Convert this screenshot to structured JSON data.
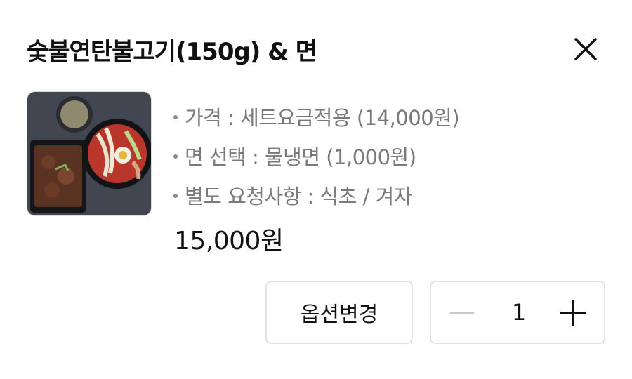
{
  "header": {
    "title": "숯불연탄불고기(150g) & 면"
  },
  "product": {
    "image_icon": "food-photo-icon",
    "options": [
      {
        "text": "가격 : 세트요금적용 (14,000원)"
      },
      {
        "text": "면 선택 : 물냉면 (1,000원)"
      },
      {
        "text": "별도 요청사항 : 식초 / 겨자"
      }
    ],
    "price": "15,000원"
  },
  "actions": {
    "change_option_label": "옵션변경",
    "quantity": "1"
  },
  "icons": {
    "close": "close-icon",
    "minus": "minus-icon",
    "plus": "plus-icon"
  },
  "colors": {
    "option_text": "#7a7a7a",
    "border": "#e2e2e2",
    "minus_disabled": "#c8c8c8"
  }
}
